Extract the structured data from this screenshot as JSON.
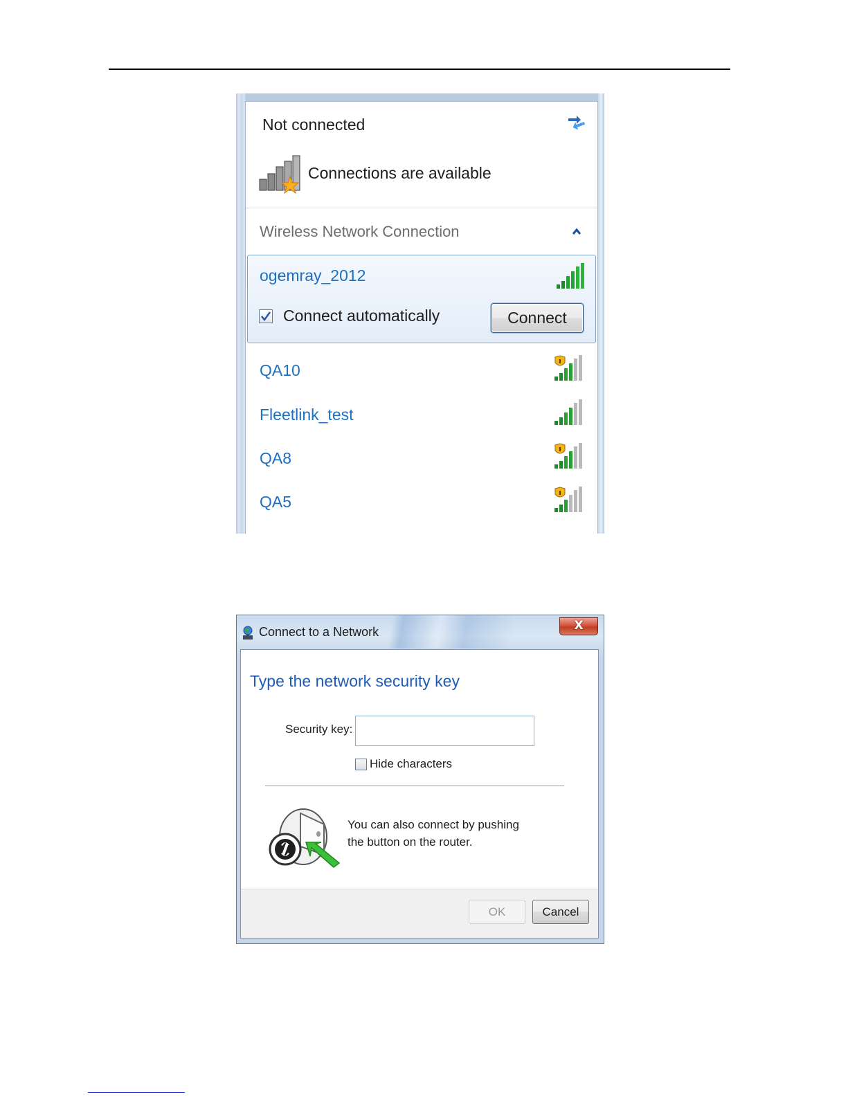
{
  "wifi_flyout": {
    "status_title": "Not connected",
    "refresh_icon": "refresh-arrows-icon",
    "availability_icon": "signal-bars-star-icon",
    "availability_text": "Connections are available",
    "section_title": "Wireless Network Connection",
    "collapse_icon": "chevron-up-icon",
    "selected_network": {
      "name": "ogemray_2012",
      "signal_icon": "signal-strength-icon",
      "connect_automatically_label": "Connect automatically",
      "connect_automatically_checked": true,
      "connect_button_label": "Connect"
    },
    "networks": [
      {
        "name": "QA10",
        "secured": true,
        "signal_icon": "secured-signal-icon"
      },
      {
        "name": "Fleetlink_test",
        "secured": false,
        "signal_icon": "signal-strength-icon"
      },
      {
        "name": "QA8",
        "secured": true,
        "signal_icon": "secured-signal-icon"
      },
      {
        "name": "QA5",
        "secured": true,
        "signal_icon": "secured-signal-icon"
      }
    ]
  },
  "dialog": {
    "title": "Connect to a Network",
    "title_icon": "network-globe-icon",
    "close_label": "X",
    "heading": "Type the network security key",
    "security_key_label": "Security key:",
    "security_key_value": "",
    "hide_characters_label": "Hide characters",
    "hide_characters_checked": false,
    "router_icon": "wps-router-button-icon",
    "router_text": "You can also connect by pushing the button on the router.",
    "ok_label": "OK",
    "cancel_label": "Cancel"
  },
  "colors": {
    "link_blue": "#1f6fbf",
    "heading_blue": "#1f5cb8",
    "close_red": "#c13d24"
  }
}
